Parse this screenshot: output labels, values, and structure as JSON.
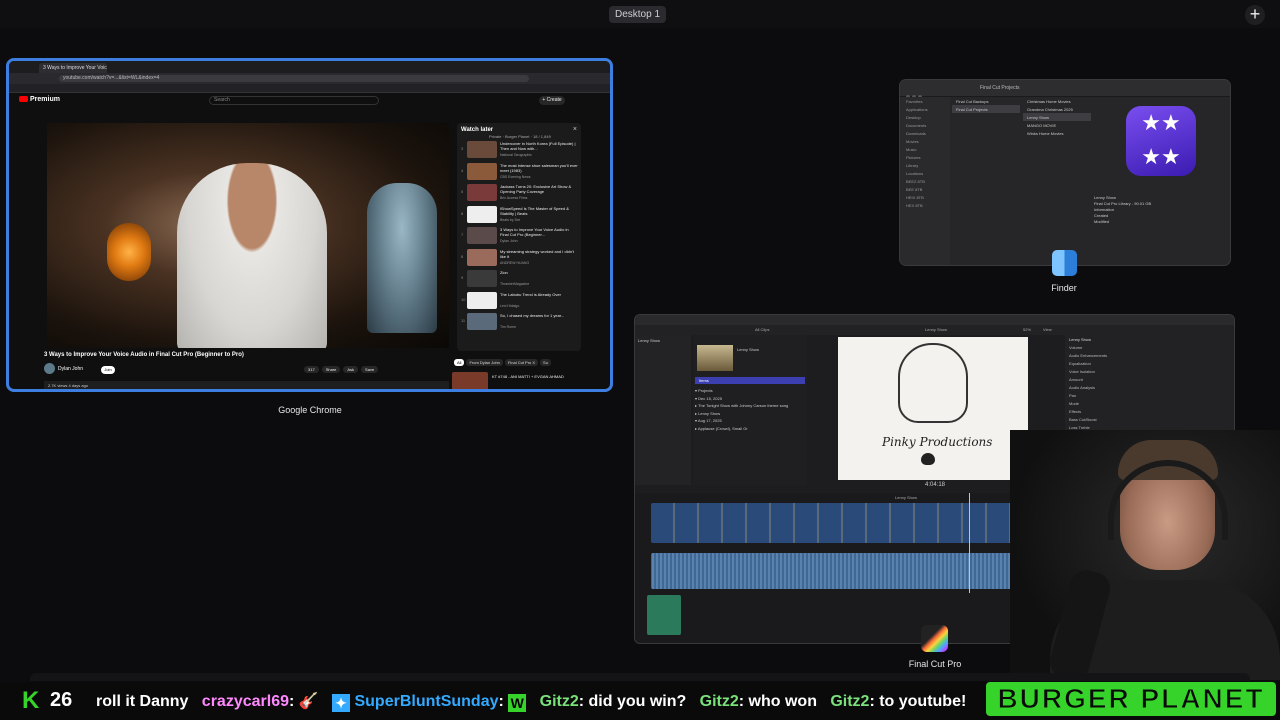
{
  "desktop": {
    "label": "Desktop 1",
    "add_label": "+"
  },
  "chrome": {
    "app_label": "Google Chrome",
    "tab_title": "3 Ways to Improve Your Voic",
    "url": "youtube.com/watch?v=...&list=WL&index=4",
    "yt_logo": "Premium",
    "search_placeholder": "Search",
    "create_label": "+ Create",
    "video_title": "3 Ways to Improve Your Voice Audio in Final Cut Pro (Beginner to Pro)",
    "channel": "Dylan John",
    "join": "Join",
    "actions": [
      "317",
      "Share",
      "Ask",
      "Save"
    ],
    "views": "2.7K views  4 days ago",
    "watch_later": {
      "title": "Watch later",
      "subtitle": "Private · Burger Planet · 18 / 1,849",
      "items": [
        {
          "n": "3",
          "title": "Undercover in North Korea (Full Episode) | Then and Now with...",
          "ch": "National Geographic",
          "color": "#6a4a3a"
        },
        {
          "n": "4",
          "title": "The most intense shoe salesman you'll ever meet (1983)",
          "ch": "CBS Evening News",
          "color": "#8a5a3a"
        },
        {
          "n": "5",
          "title": "Jackass Turns 20: Exclusive Art Show & Opening Party Coverage",
          "ch": "Brix Access Films",
          "color": "#7a3a3a"
        },
        {
          "n": "6",
          "title": "iShowSpeed Is The Master of Speed & Stability | Beats",
          "ch": "Beats by Dre",
          "color": "#eeeeee"
        },
        {
          "n": "7",
          "title": "3 Ways to Improve Your Voice Audio in Final Cut Pro (Beginner...",
          "ch": "Dylan John",
          "color": "#5a4a4a"
        },
        {
          "n": "8",
          "title": "My streaming strategy worked and I didn't like it",
          "ch": "ANDREW HUANG",
          "color": "#9a6a5a"
        },
        {
          "n": "9",
          "title": "Zion",
          "ch": "ThrasherMagazine",
          "color": "#3a3a3a"
        },
        {
          "n": "10",
          "title": "The Labubu Trend is Already Over",
          "ch": "Lexi Hidalgo",
          "color": "#eeeeee"
        },
        {
          "n": "11",
          "title": "So, I chased my dreams for 1 year...",
          "ch": "Tim Rome",
          "color": "#5a6a7a"
        }
      ],
      "close": "×"
    },
    "chips": [
      "All",
      "From Dylan John",
      "Final Cut Pro X",
      "Su"
    ],
    "rec_title": "KT #748 - ANI MATTI + EVGAN AHMAD"
  },
  "finder": {
    "app_label": "Finder",
    "title": "Final Cut Projects",
    "sidebar": [
      "Favorites",
      "Applications",
      "Desktop",
      "Documents",
      "Downloads",
      "Movies",
      "Music",
      "Pictures",
      "Library",
      "Locations",
      "BEEZ 8TB",
      "BEE 8TB",
      "HEIX 8TB",
      "HEX 8TB"
    ],
    "col1": [
      "Final Cut Backups",
      "Final Cut Projects"
    ],
    "col2": [
      "Christmas Home Movies",
      "Grandma Christmas 2025",
      "Lenny Show",
      "MANGO MOVIE",
      "Winks Home Movies"
    ],
    "info_name": "Lenny Show",
    "info_kind": "Final Cut Pro Library - 90.01 GB",
    "info_heading": "Information",
    "info_created": "Created",
    "info_modified": "Modified",
    "icon_glyph": "★★\n★★"
  },
  "fcp": {
    "app_label": "Final Cut Pro",
    "library": "Lenny Show",
    "all_clips": "All Clips",
    "clip_name": "Lenny Show",
    "highlight": "Items",
    "projects": [
      "▾ Projects",
      "▾ Dec 15, 2025",
      "  ▸ The Tonight Show with Johnny Carson theme song",
      "  ▸ Lenny Show",
      "▾ Aug 17, 2025",
      "  ▸ Applause (Crowd), Small Gr"
    ],
    "viewer_text": "Pinky Productions",
    "timecode": "4:04:18",
    "zoom": "52%",
    "view": "View",
    "inspector_title": "Lenny Show",
    "inspector": [
      "Volume",
      "Audio Enhancements",
      "Equalization",
      "Voice Isolation",
      "Amount",
      "Audio Analysis",
      "Pan",
      "Mode",
      "Effects",
      "Bass Cut/Boost",
      "Loss Treble",
      "Amount",
      "Audio Configuration"
    ],
    "timeline_label": "Lenny Show"
  },
  "ticker": {
    "k": "K",
    "count": "26",
    "messages": [
      {
        "user": "",
        "text": "roll it Danny"
      },
      {
        "user": "crazycarl69",
        "text": ": 🎸"
      },
      {
        "user": "SuperBluntSunday",
        "text": ":"
      },
      {
        "user": "Gitz2",
        "text": ": did you win?"
      },
      {
        "user": "Gitz2",
        "text": ": who won"
      },
      {
        "user": "Gitz2",
        "text": ": to youtube!"
      }
    ],
    "brand": "BURGER PLANET"
  }
}
